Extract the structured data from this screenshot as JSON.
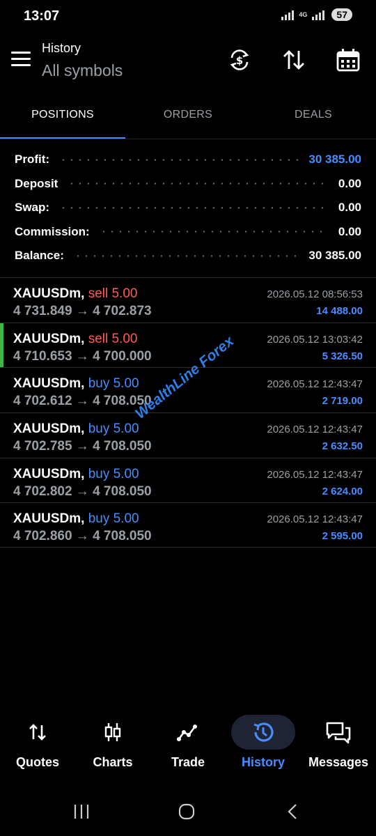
{
  "status_bar": {
    "time": "13:07",
    "network": "4G",
    "battery": "57"
  },
  "header": {
    "title": "History",
    "subtitle": "All symbols"
  },
  "tabs": [
    {
      "label": "POSITIONS",
      "active": true
    },
    {
      "label": "ORDERS",
      "active": false
    },
    {
      "label": "DEALS",
      "active": false
    }
  ],
  "summary": [
    {
      "label": "Profit:",
      "value": "30 385.00"
    },
    {
      "label": "Deposit",
      "value": "0.00"
    },
    {
      "label": "Swap:",
      "value": "0.00"
    },
    {
      "label": "Commission:",
      "value": "0.00"
    },
    {
      "label": "Balance:",
      "value": "30 385.00"
    }
  ],
  "deals": [
    {
      "symbol": "XAUUSDm,",
      "side": "sell 5.00",
      "prices": "4 731.849 → 4 702.873",
      "time": "2026.05.12 08:56:53",
      "profit": "14 488.00"
    },
    {
      "symbol": "XAUUSDm,",
      "side": "sell 5.00",
      "prices": "4 710.653 → 4 700.000",
      "time": "2026.05.12 13:03:42",
      "profit": "5 326.50"
    },
    {
      "symbol": "XAUUSDm,",
      "side": "buy 5.00",
      "prices": "4 702.612 → 4 708.050",
      "time": "2026.05.12 12:43:47",
      "profit": "2 719.00"
    },
    {
      "symbol": "XAUUSDm,",
      "side": "buy 5.00",
      "prices": "4 702.785 → 4 708.050",
      "time": "2026.05.12 12:43:47",
      "profit": "2 632.50"
    },
    {
      "symbol": "XAUUSDm,",
      "side": "buy 5.00",
      "prices": "4 702.802 → 4 708.050",
      "time": "2026.05.12 12:43:47",
      "profit": "2 624.00"
    },
    {
      "symbol": "XAUUSDm,",
      "side": "buy 5.00",
      "prices": "4 702.860 → 4 708.050",
      "time": "2026.05.12 12:43:47",
      "profit": "2 595.00"
    }
  ],
  "watermark": "WealthLine Forex",
  "bottom_nav": [
    {
      "label": "Quotes",
      "icon": "quotes-icon"
    },
    {
      "label": "Charts",
      "icon": "candlestick-icon"
    },
    {
      "label": "Trade",
      "icon": "trade-line-icon"
    },
    {
      "label": "History",
      "icon": "history-icon",
      "active": true
    },
    {
      "label": "Messages",
      "icon": "messages-icon"
    }
  ],
  "colors": {
    "accent": "#4a8cff",
    "sell": "#ff5a5a",
    "buy": "#4a8cff",
    "marker": "#3cb94a",
    "background": "#000000"
  }
}
